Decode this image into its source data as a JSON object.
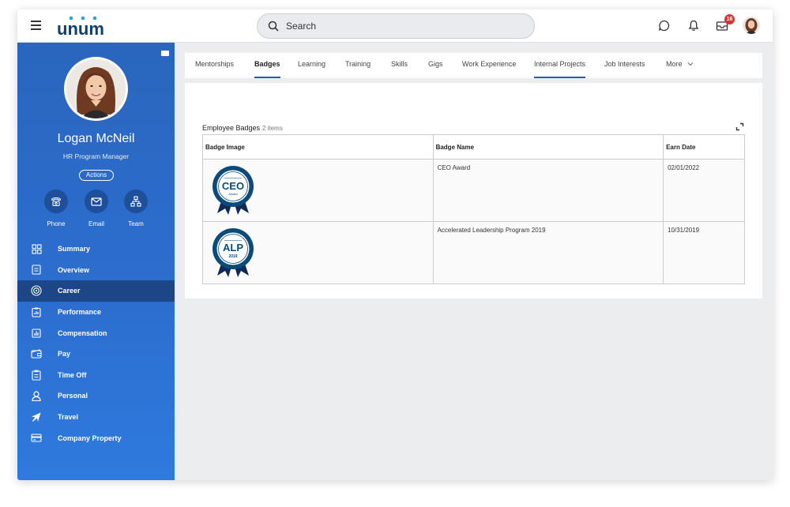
{
  "app": {
    "logo_text": "unum",
    "search_placeholder": "Search",
    "inbox_count": "16",
    "icons": [
      "menu-icon",
      "search-icon",
      "chat-icon",
      "bell-icon",
      "inbox-icon"
    ]
  },
  "profile": {
    "name": "Logan McNeil",
    "title": "HR Program Manager",
    "actions_label": "Actions",
    "contacts": [
      {
        "label": "Phone",
        "icon": "phone-icon"
      },
      {
        "label": "Email",
        "icon": "email-icon"
      },
      {
        "label": "Team",
        "icon": "team-icon"
      }
    ]
  },
  "sidebar": {
    "items": [
      {
        "label": "Summary",
        "icon": "summary-icon"
      },
      {
        "label": "Overview",
        "icon": "overview-icon"
      },
      {
        "label": "Career",
        "icon": "career-icon",
        "active": true
      },
      {
        "label": "Performance",
        "icon": "performance-icon"
      },
      {
        "label": "Compensation",
        "icon": "compensation-icon"
      },
      {
        "label": "Pay",
        "icon": "pay-icon"
      },
      {
        "label": "Time Off",
        "icon": "time-off-icon"
      },
      {
        "label": "Personal",
        "icon": "personal-icon"
      },
      {
        "label": "Travel",
        "icon": "travel-icon"
      },
      {
        "label": "Company Property",
        "icon": "company-property-icon"
      }
    ]
  },
  "tabs": [
    {
      "label": "Mentorships"
    },
    {
      "label": "Badges",
      "active": true
    },
    {
      "label": "Learning"
    },
    {
      "label": "Training"
    },
    {
      "label": "Skills"
    },
    {
      "label": "Gigs"
    },
    {
      "label": "Work Experience"
    },
    {
      "label": "Internal Projects",
      "underlined": true
    },
    {
      "label": "Job Interests"
    },
    {
      "label": "More"
    }
  ],
  "badges_grid": {
    "title": "Employee Badges",
    "count": "2 items",
    "columns": [
      "Badge Image",
      "Badge Name",
      "Earn Date"
    ],
    "rows": [
      {
        "image_text": "CEO",
        "image_subtext": "Award",
        "name": "CEO Award",
        "date": "02/01/2022"
      },
      {
        "image_text": "ALP",
        "image_subtext": "2019",
        "name": "Accelerated Leadership Program 2019",
        "date": "10/31/2019"
      }
    ]
  },
  "colors": {
    "brand_blue": "#1b5fc1",
    "sidebar_top": "#2a66bd",
    "sidebar_bottom": "#2f7ade",
    "badge_navy": "#0c4a7a",
    "badge_dark": "#102a57",
    "notification_red": "#d83232"
  }
}
